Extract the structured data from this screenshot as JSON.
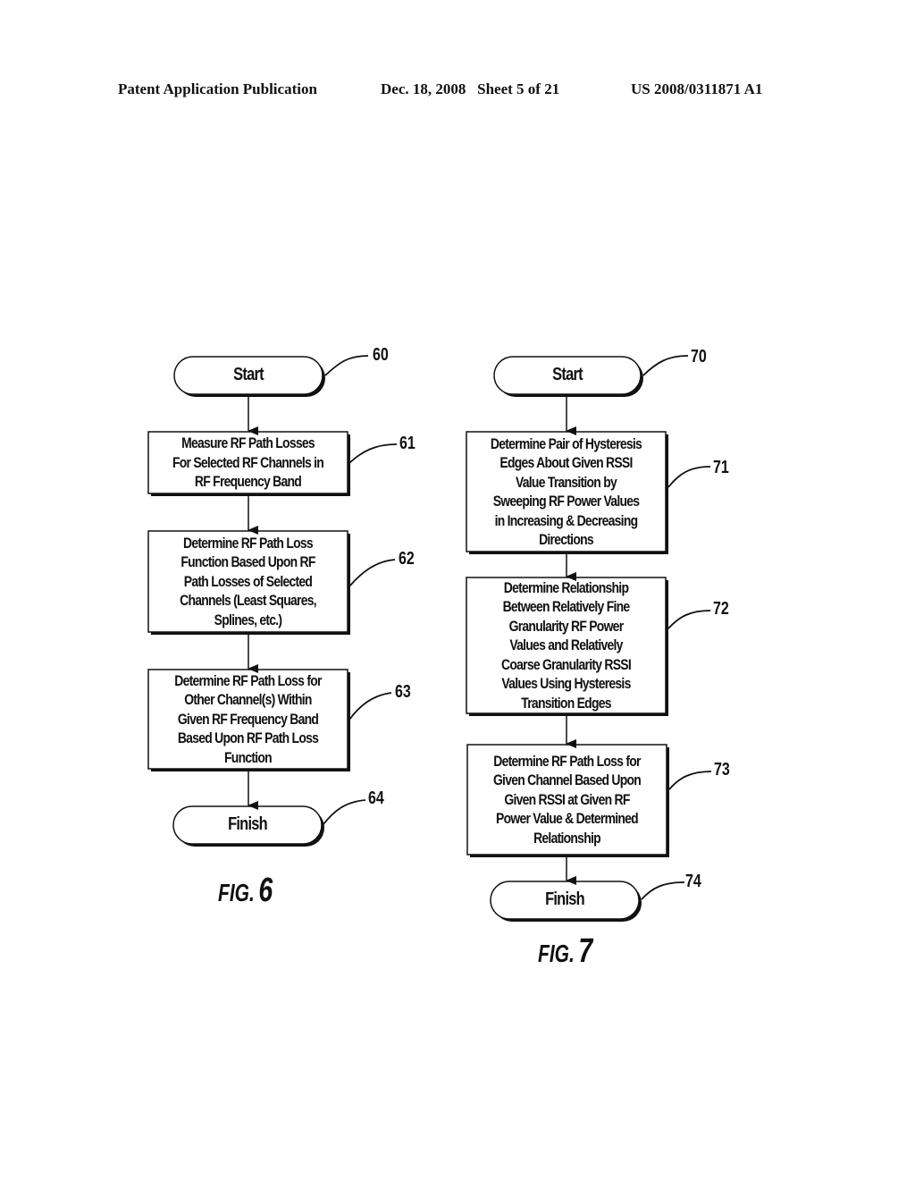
{
  "header": {
    "publication": "Patent Application Publication",
    "date_sheet": "Dec. 18, 2008   Sheet 5 of 21",
    "patent_number": "US 2008/0311871 A1"
  },
  "figures": [
    {
      "label_prefix": "FIG.",
      "label_number": "6",
      "nodes": [
        {
          "ref": "60",
          "type": "terminal",
          "text": "Start"
        },
        {
          "ref": "61",
          "type": "process",
          "text": "Measure RF Path Losses\nFor Selected RF Channels in\nRF Frequency Band"
        },
        {
          "ref": "62",
          "type": "process",
          "text": "Determine RF Path Loss\nFunction Based Upon RF\nPath Losses of Selected\nChannels (Least Squares,\nSplines, etc.)"
        },
        {
          "ref": "63",
          "type": "process",
          "text": "Determine RF Path Loss for\nOther Channel(s) Within\nGiven RF Frequency Band\nBased Upon RF Path Loss\nFunction"
        },
        {
          "ref": "64",
          "type": "terminal",
          "text": "Finish"
        }
      ]
    },
    {
      "label_prefix": "FIG.",
      "label_number": "7",
      "nodes": [
        {
          "ref": "70",
          "type": "terminal",
          "text": "Start"
        },
        {
          "ref": "71",
          "type": "process",
          "text": "Determine Pair of Hysteresis\nEdges About Given RSSI\nValue Transition by\nSweeping RF Power Values\nin Increasing & Decreasing\nDirections"
        },
        {
          "ref": "72",
          "type": "process",
          "text": "Determine Relationship\nBetween Relatively Fine\nGranularity RF Power\nValues and Relatively\nCoarse Granularity RSSI\nValues Using Hysteresis\nTransition Edges"
        },
        {
          "ref": "73",
          "type": "process",
          "text": "Determine RF Path Loss for\nGiven Channel Based Upon\nGiven RSSI at Given RF\nPower Value & Determined\nRelationship"
        },
        {
          "ref": "74",
          "type": "terminal",
          "text": "Finish"
        }
      ]
    }
  ]
}
